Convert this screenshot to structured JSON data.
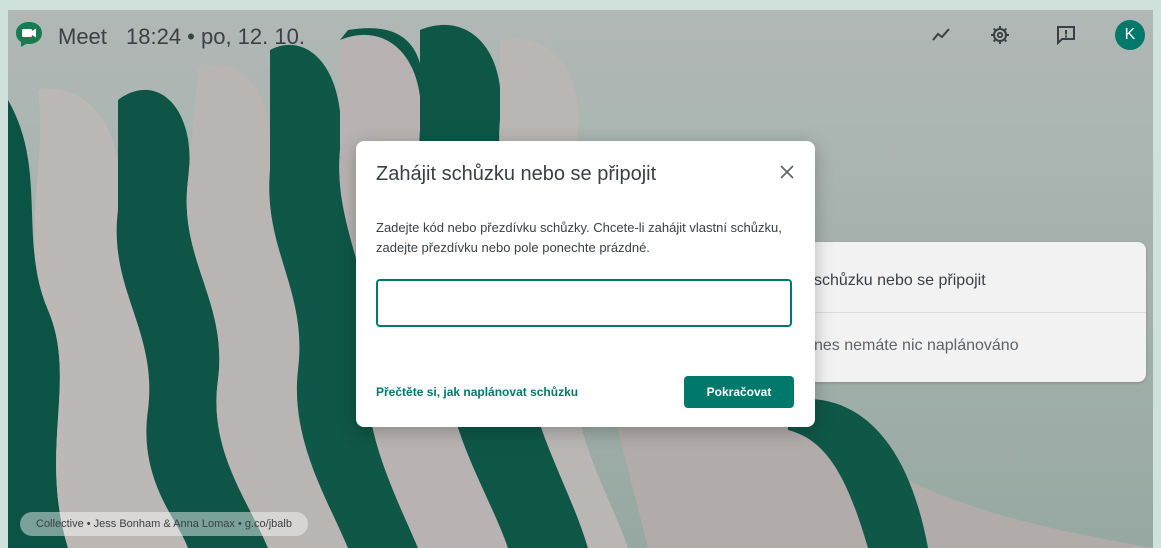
{
  "app": {
    "name": "Meet",
    "separator": "•",
    "time_date": "18:24  •  po, 12. 10."
  },
  "topbar": {
    "icons": [
      "trend-icon",
      "gear-icon",
      "feedback-icon"
    ],
    "avatar_initial": "K"
  },
  "background_card": {
    "item_start": "schůzku nebo se připojit",
    "item_none": "nes nemáte nic naplánováno"
  },
  "attribution": "Collective  •  Jess Bonham & Anna Lomax  •  g.co/jbalb",
  "dialog": {
    "title": "Zahájit schůzku nebo se připojit",
    "description": "Zadejte kód nebo přezdívku schůzky. Chcete-li zahájit vlastní schůzku, zadejte přezdívku nebo pole ponechte prázdné.",
    "input_value": "",
    "help_link": "Přečtěte si, jak naplánovat schůzku",
    "continue_label": "Pokračovat"
  },
  "colors": {
    "accent": "#00796b",
    "avatar_bg": "#00796b",
    "text": "#3c4043"
  }
}
